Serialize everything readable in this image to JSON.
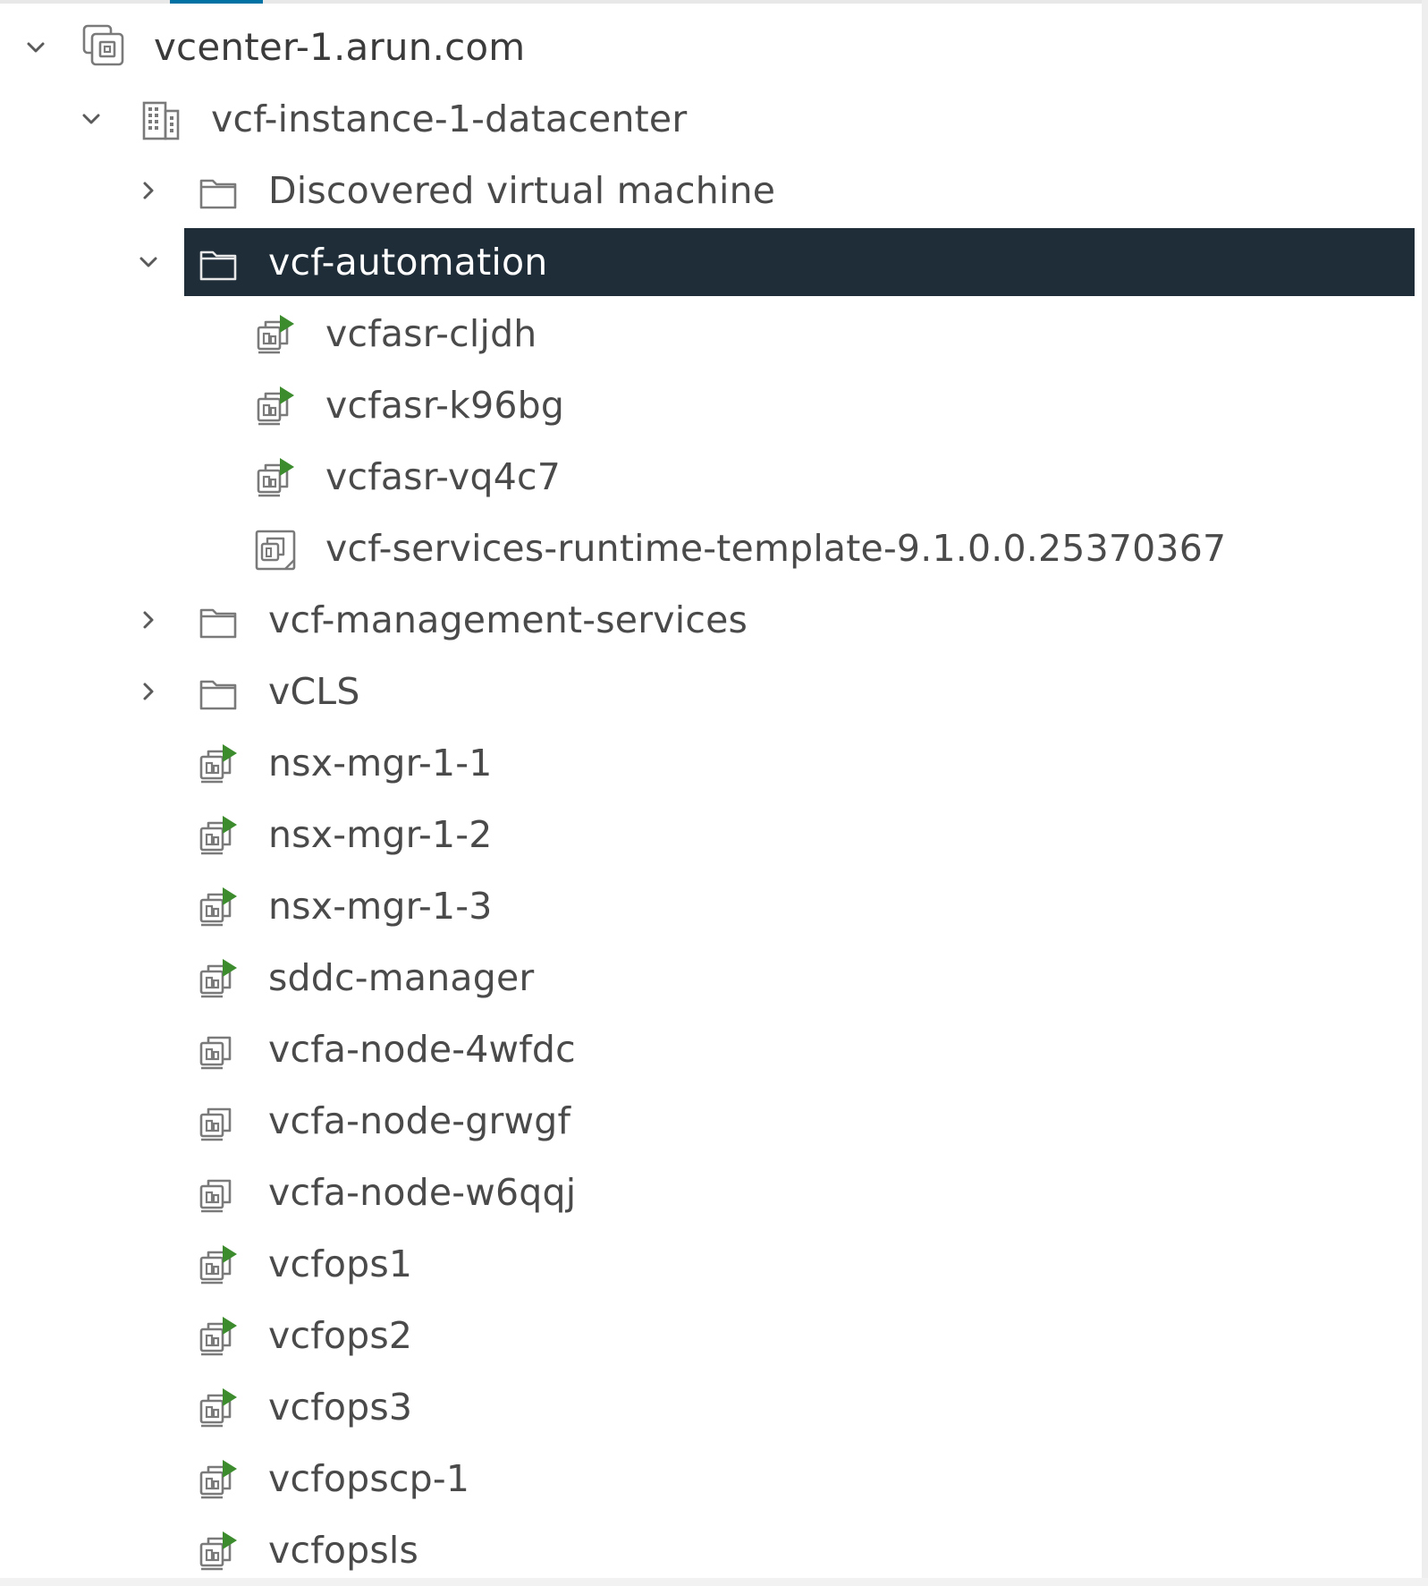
{
  "tree": {
    "root": {
      "label": "vcenter-1.arun.com",
      "icon": "vcenter-icon",
      "expanded": true
    },
    "datacenter": {
      "label": "vcf-instance-1-datacenter",
      "icon": "datacenter-icon",
      "expanded": true
    },
    "folders": {
      "discovered": {
        "label": "Discovered virtual machine",
        "icon": "folder-icon",
        "expanded": false
      },
      "automation": {
        "label": "vcf-automation",
        "icon": "folder-icon",
        "expanded": true,
        "selected": true
      },
      "management": {
        "label": "vcf-management-services",
        "icon": "folder-icon",
        "expanded": false
      },
      "vcls": {
        "label": "vCLS",
        "icon": "folder-icon",
        "expanded": false
      }
    },
    "automation_children": [
      {
        "label": "vcfasr-cljdh",
        "icon": "vm-powered-on-icon"
      },
      {
        "label": "vcfasr-k96bg",
        "icon": "vm-powered-on-icon"
      },
      {
        "label": "vcfasr-vq4c7",
        "icon": "vm-powered-on-icon"
      },
      {
        "label": "vcf-services-runtime-template-9.1.0.0.25370367",
        "icon": "vm-template-icon"
      }
    ],
    "vms": [
      {
        "label": "nsx-mgr-1-1",
        "icon": "vm-powered-on-icon"
      },
      {
        "label": "nsx-mgr-1-2",
        "icon": "vm-powered-on-icon"
      },
      {
        "label": "nsx-mgr-1-3",
        "icon": "vm-powered-on-icon"
      },
      {
        "label": "sddc-manager",
        "icon": "vm-powered-on-icon"
      },
      {
        "label": "vcfa-node-4wfdc",
        "icon": "vm-powered-off-icon"
      },
      {
        "label": "vcfa-node-grwgf",
        "icon": "vm-powered-off-icon"
      },
      {
        "label": "vcfa-node-w6qqj",
        "icon": "vm-powered-off-icon"
      },
      {
        "label": "vcfops1",
        "icon": "vm-powered-on-icon"
      },
      {
        "label": "vcfops2",
        "icon": "vm-powered-on-icon"
      },
      {
        "label": "vcfops3",
        "icon": "vm-powered-on-icon"
      },
      {
        "label": "vcfopscp-1",
        "icon": "vm-powered-on-icon"
      },
      {
        "label": "vcfopsls",
        "icon": "vm-powered-on-icon"
      }
    ]
  },
  "colors": {
    "selected_background": "#1f2d38",
    "selected_text": "#ffffff",
    "text": "#4a4a4a",
    "power_on_green": "#3c8c2e",
    "icon_stroke": "#6b6b6b",
    "tab_indicator": "#0072a3"
  }
}
